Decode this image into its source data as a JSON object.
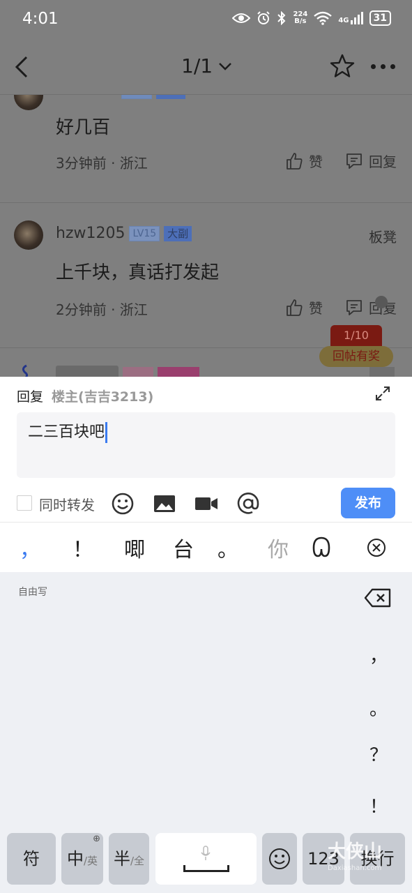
{
  "status_bar": {
    "time": "4:01",
    "net_speed_value": "224",
    "net_speed_unit": "B/s",
    "network_type": "4G",
    "battery_level": "31"
  },
  "nav": {
    "pager": "1/1"
  },
  "posts": [
    {
      "text": "好几百",
      "meta": "3分钟前 · 浙江",
      "like_label": "赞",
      "reply_label": "回复"
    },
    {
      "username": "hzw1205",
      "level": "LV15",
      "rank_badge": "大副",
      "floor": "板凳",
      "text": "上千块，真话打发起",
      "meta": "2分钟前 · 浙江",
      "like_label": "赞",
      "reply_label": "回复"
    }
  ],
  "floating": {
    "page_indicator": "1/10",
    "reward_label": "回帖有奖"
  },
  "reply_sheet": {
    "reply_label": "回复",
    "reply_target": "楼主(吉吉3213)",
    "input_value": "二三百块吧",
    "forward_label": "同时转发",
    "publish_label": "发布"
  },
  "ime": {
    "candidates": [
      "，",
      "！",
      "唧",
      "台",
      "。",
      "你"
    ],
    "mode_label": "自由写",
    "side_punct": [
      "，",
      "。",
      "？",
      "！"
    ],
    "keys": {
      "symbol": "符",
      "lang_main": "中",
      "lang_sub": "/英",
      "width_main": "半",
      "width_sub": "/全",
      "numbers": "123",
      "newline": "换行"
    }
  },
  "watermark": {
    "text": "大侠山",
    "sub": "Daxiashan.com"
  },
  "colors": {
    "accent": "#4e8ef7",
    "dim_overlay": "#7f7f7f",
    "keyboard_bg": "#eef0f4"
  }
}
